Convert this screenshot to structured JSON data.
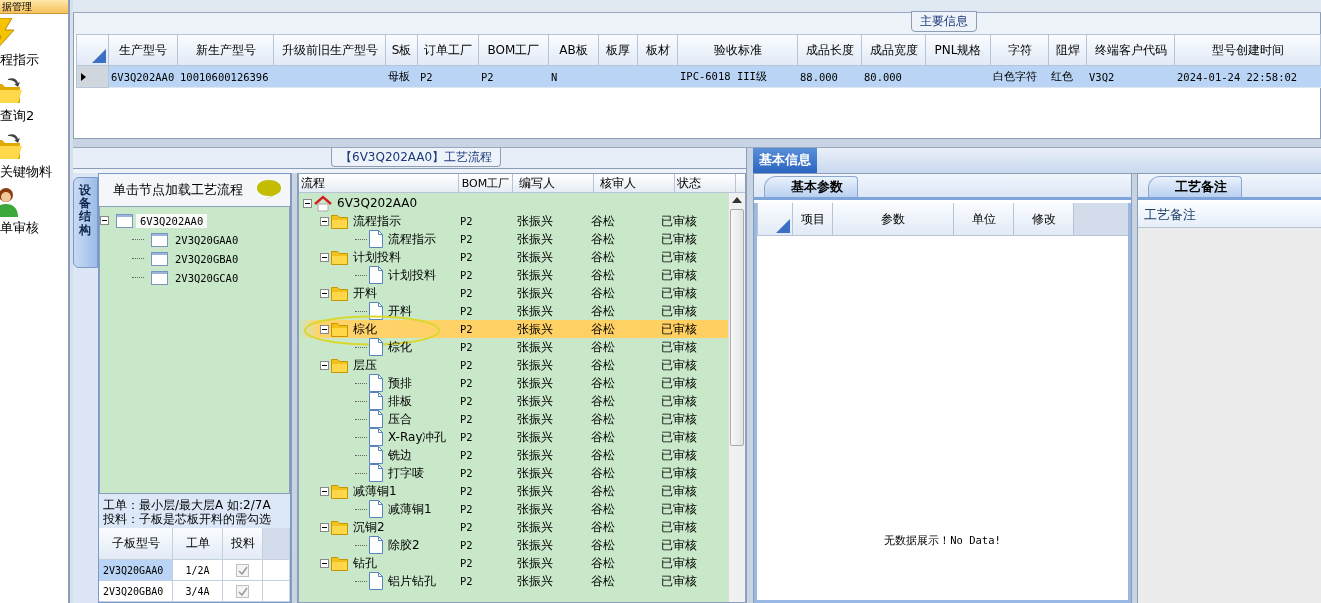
{
  "sidebar": {
    "header": "据管理",
    "items": [
      {
        "label": "程指示",
        "kind": "bolt"
      },
      {
        "label": "查询2",
        "kind": "folder"
      },
      {
        "label": "关键物料",
        "kind": "folder"
      },
      {
        "label": "单审核",
        "kind": "person"
      }
    ]
  },
  "main_info": {
    "title": "主要信息",
    "columns": [
      "生产型号",
      "新生产型号",
      "升级前旧生产型号",
      "S板",
      "订单工厂",
      "BOM工厂",
      "AB板",
      "板厚",
      "板材",
      "验收标准",
      "成品长度",
      "成品宽度",
      "PNL规格",
      "字符",
      "阻焊",
      "终端客户代码",
      "型号创建时间"
    ],
    "rows": [
      {
        "selected": true,
        "cells": [
          "6V3Q202AA0",
          "10010600126396",
          null,
          "母板",
          "P2",
          "P2",
          "N",
          null,
          null,
          "IPC-6018 III级",
          "88.000",
          "80.000",
          null,
          "白色字符",
          "红色",
          "V3Q2",
          "2024-01-24 22:58:02"
        ]
      }
    ]
  },
  "flow_panel": {
    "title": "【6V3Q202AA0】工艺流程",
    "structure_tab": "设备结构",
    "hint": "单击节点加载工艺流程",
    "tree": [
      {
        "label": "6V3Q202AA0",
        "expanded": true,
        "selected": true,
        "children": [
          {
            "label": "2V3Q20GAA0",
            "selected": false
          },
          {
            "label": "2V3Q20GBA0",
            "selected": false
          },
          {
            "label": "2V3Q20GCA0",
            "selected": false
          }
        ]
      }
    ],
    "notes": [
      "工单：最小层/最大层A 如:2/7A",
      "投料：子板是芯板开料的需勾选"
    ],
    "sub_table": {
      "columns": [
        "子板型号",
        "工单",
        "投料"
      ],
      "rows": [
        {
          "selected": true,
          "model": "2V3Q20GAA0",
          "order": "1/2A",
          "checked": true
        },
        {
          "selected": false,
          "model": "2V3Q20GBA0",
          "order": "3/4A",
          "checked": true
        }
      ]
    }
  },
  "flow_tree": {
    "columns": [
      "流程",
      "BOM工厂",
      "编写人",
      "核审人",
      "状态"
    ],
    "root": {
      "label": "6V3Q202AA0",
      "kind": "home",
      "expanded": true,
      "selected": false,
      "children": [
        {
          "label": "流程指示",
          "kind": "folder",
          "expanded": true,
          "selected": false,
          "cells": [
            "P2",
            "张振兴",
            "谷松",
            "已审核"
          ],
          "children": [
            {
              "label": "流程指示",
              "kind": "step",
              "selected": false,
              "cells": [
                "P2",
                "张振兴",
                "谷松",
                "已审核"
              ]
            }
          ]
        },
        {
          "label": "计划投料",
          "kind": "folder",
          "expanded": true,
          "selected": false,
          "cells": [
            "P2",
            "张振兴",
            "谷松",
            "已审核"
          ],
          "children": [
            {
              "label": "计划投料",
              "kind": "step",
              "selected": false,
              "cells": [
                "P2",
                "张振兴",
                "谷松",
                "已审核"
              ]
            }
          ]
        },
        {
          "label": "开料",
          "kind": "folder",
          "expanded": true,
          "selected": false,
          "cells": [
            "P2",
            "张振兴",
            "谷松",
            "已审核"
          ],
          "children": [
            {
              "label": "开料",
              "kind": "step",
              "selected": false,
              "cells": [
                "P2",
                "张振兴",
                "谷松",
                "已审核"
              ]
            }
          ]
        },
        {
          "label": "棕化",
          "kind": "folder",
          "expanded": true,
          "selected": true,
          "cells": [
            "P2",
            "张振兴",
            "谷松",
            "已审核"
          ],
          "children": [
            {
              "label": "棕化",
              "kind": "step",
              "selected": false,
              "cells": [
                "P2",
                "张振兴",
                "谷松",
                "已审核"
              ]
            }
          ]
        },
        {
          "label": "层压",
          "kind": "folder",
          "expanded": true,
          "selected": false,
          "cells": [
            "P2",
            "张振兴",
            "谷松",
            "已审核"
          ],
          "children": [
            {
              "label": "预排",
              "kind": "step",
              "selected": false,
              "cells": [
                "P2",
                "张振兴",
                "谷松",
                "已审核"
              ]
            },
            {
              "label": "排板",
              "kind": "step",
              "selected": false,
              "cells": [
                "P2",
                "张振兴",
                "谷松",
                "已审核"
              ]
            },
            {
              "label": "压合",
              "kind": "step",
              "selected": false,
              "cells": [
                "P2",
                "张振兴",
                "谷松",
                "已审核"
              ]
            },
            {
              "label": "X-Ray冲孔",
              "kind": "step",
              "selected": false,
              "cells": [
                "P2",
                "张振兴",
                "谷松",
                "已审核"
              ]
            },
            {
              "label": "铣边",
              "kind": "step",
              "selected": false,
              "cells": [
                "P2",
                "张振兴",
                "谷松",
                "已审核"
              ]
            },
            {
              "label": "打字唛",
              "kind": "step",
              "selected": false,
              "cells": [
                "P2",
                "张振兴",
                "谷松",
                "已审核"
              ]
            }
          ]
        },
        {
          "label": "减薄铜1",
          "kind": "folder",
          "expanded": true,
          "selected": false,
          "cells": [
            "P2",
            "张振兴",
            "谷松",
            "已审核"
          ],
          "children": [
            {
              "label": "减薄铜1",
              "kind": "step",
              "selected": false,
              "cells": [
                "P2",
                "张振兴",
                "谷松",
                "已审核"
              ]
            }
          ]
        },
        {
          "label": "沉铜2",
          "kind": "folder",
          "expanded": true,
          "selected": false,
          "cells": [
            "P2",
            "张振兴",
            "谷松",
            "已审核"
          ],
          "children": [
            {
              "label": "除胶2",
              "kind": "step",
              "selected": false,
              "cells": [
                "P2",
                "张振兴",
                "谷松",
                "已审核"
              ]
            }
          ]
        },
        {
          "label": "钻孔",
          "kind": "folder",
          "expanded": true,
          "selected": false,
          "cells": [
            "P2",
            "张振兴",
            "谷松",
            "已审核"
          ],
          "children": [
            {
              "label": "铝片钻孔",
              "kind": "step",
              "selected": false,
              "cells": [
                "P2",
                "张振兴",
                "谷松",
                "已审核"
              ]
            }
          ]
        }
      ]
    }
  },
  "info_tabs": [
    {
      "label": "基本信息",
      "selected": true
    }
  ],
  "params": {
    "tab": "基本参数",
    "columns": [
      "项目",
      "参数",
      "单位",
      "修改"
    ],
    "empty_text": "无数据展示！No Data!"
  },
  "remarks": {
    "tab": "工艺备注",
    "label": "工艺备注"
  }
}
